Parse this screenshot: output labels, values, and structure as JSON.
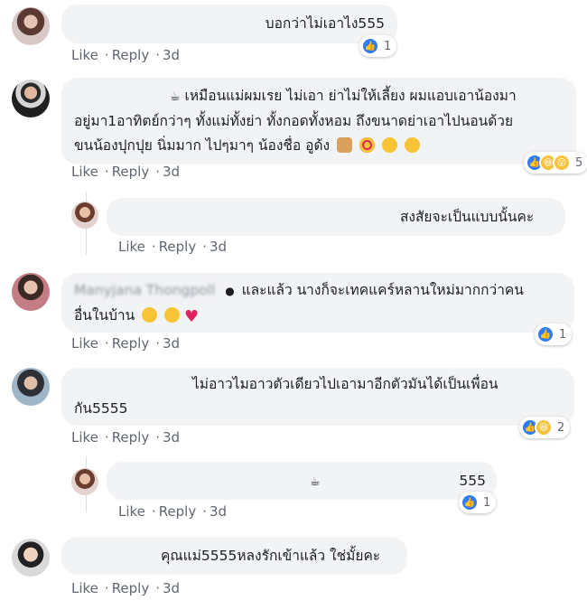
{
  "action_labels": {
    "like": "Like",
    "reply": "Reply",
    "time": "3d"
  },
  "comments": [
    {
      "text": "บอกว่าไม่เอาไง555",
      "reactions": 1
    },
    {
      "text_lines": [
        "เหมือนแม่ผมเรย ไม่เอา ย่าไม่ให้เลี้ยง ผมแอบเอาน้องมา",
        "อยู่มา1อาทิตย์กว่าๆ ทั้งแม่ทั้งย่า ทั้งกอดทั้งหอม ถึงขนาดย่าเอาไปนอนด้วย",
        "ขนน้องปุกปุย นิ่มมาก ไปๆมาๆ น้องชื่อ อูด้ง"
      ],
      "reactions": 5
    },
    {
      "text": "สงสัยจะเป็นแบบนั้นคะ"
    },
    {
      "name": "Manyjana Thongpoll",
      "text_lines": [
        "และแล้ว นางก็จะเทคแคร์หลานใหม่มากกว่าคน",
        "อื่นในบ้าน"
      ],
      "reactions": 1
    },
    {
      "text_lines": [
        "ไม่อาวไมอาวตัวเดียวไปเอามาอีกตัวมันได้เป็นเพื่อน",
        "กัน5555"
      ],
      "reactions": 2
    },
    {
      "text": "555",
      "reactions": 1
    },
    {
      "text": "คุณแม่5555หลงรักเข้าแล้ว ใช่มั้ยคะ"
    }
  ]
}
